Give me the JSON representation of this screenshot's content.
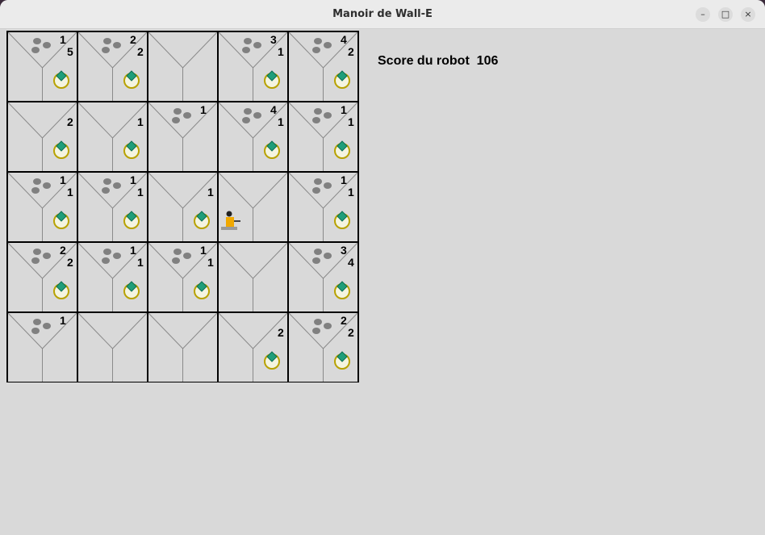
{
  "window": {
    "title": "Manoir de Wall-E",
    "minimize_glyph": "–",
    "maximize_glyph": "□",
    "close_glyph": "×"
  },
  "score": {
    "label": "Score du robot",
    "value": "106"
  },
  "robot": {
    "row": 2,
    "col": 3
  },
  "colors": {
    "dust": "#808080",
    "jewel_ring": "#b8a200",
    "jewel": "#1f9e7a",
    "robot_body": "#f0a800",
    "cell_bg": "#d9d9d9",
    "border": "#000000"
  },
  "grid": {
    "rows": 5,
    "cols": 5,
    "cells": [
      [
        {
          "dust": true,
          "jewel": true,
          "top_num": "1",
          "right_num": "5"
        },
        {
          "dust": true,
          "jewel": true,
          "top_num": "2",
          "right_num": "2"
        },
        {
          "dust": false,
          "jewel": false,
          "top_num": "",
          "right_num": ""
        },
        {
          "dust": true,
          "jewel": true,
          "top_num": "3",
          "right_num": "1"
        },
        {
          "dust": true,
          "jewel": true,
          "top_num": "4",
          "right_num": "2"
        }
      ],
      [
        {
          "dust": false,
          "jewel": true,
          "top_num": "",
          "right_num": "2"
        },
        {
          "dust": false,
          "jewel": true,
          "top_num": "",
          "right_num": "1"
        },
        {
          "dust": true,
          "jewel": false,
          "top_num": "1",
          "right_num": ""
        },
        {
          "dust": true,
          "jewel": true,
          "top_num": "4",
          "right_num": "1"
        },
        {
          "dust": true,
          "jewel": true,
          "top_num": "1",
          "right_num": "1"
        }
      ],
      [
        {
          "dust": true,
          "jewel": true,
          "top_num": "1",
          "right_num": "1"
        },
        {
          "dust": true,
          "jewel": true,
          "top_num": "1",
          "right_num": "1"
        },
        {
          "dust": false,
          "jewel": true,
          "top_num": "",
          "right_num": "1"
        },
        {
          "dust": false,
          "jewel": false,
          "top_num": "",
          "right_num": ""
        },
        {
          "dust": true,
          "jewel": true,
          "top_num": "1",
          "right_num": "1"
        }
      ],
      [
        {
          "dust": true,
          "jewel": true,
          "top_num": "2",
          "right_num": "2"
        },
        {
          "dust": true,
          "jewel": true,
          "top_num": "1",
          "right_num": "1"
        },
        {
          "dust": true,
          "jewel": true,
          "top_num": "1",
          "right_num": "1"
        },
        {
          "dust": false,
          "jewel": false,
          "top_num": "",
          "right_num": ""
        },
        {
          "dust": true,
          "jewel": true,
          "top_num": "3",
          "right_num": "4"
        }
      ],
      [
        {
          "dust": true,
          "jewel": false,
          "top_num": "1",
          "right_num": ""
        },
        {
          "dust": false,
          "jewel": false,
          "top_num": "",
          "right_num": ""
        },
        {
          "dust": false,
          "jewel": false,
          "top_num": "",
          "right_num": ""
        },
        {
          "dust": false,
          "jewel": true,
          "top_num": "",
          "right_num": "2"
        },
        {
          "dust": true,
          "jewel": true,
          "top_num": "2",
          "right_num": "2"
        }
      ]
    ]
  }
}
